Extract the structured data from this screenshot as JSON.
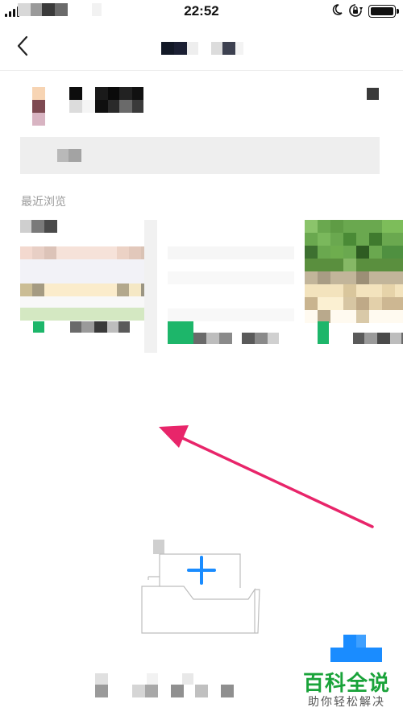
{
  "status_bar": {
    "time": "22:52",
    "battery_level": 1.0,
    "icons": [
      "signal-icon",
      "moon-icon",
      "rotation-lock-icon",
      "battery-icon"
    ]
  },
  "nav": {
    "back_icon": "chevron-left-icon"
  },
  "recent": {
    "section_title": "最近浏览"
  },
  "annotation": {
    "arrow_color": "#e8256a",
    "arrow_icon": "arrow-icon"
  },
  "empty_state": {
    "icon": "empty-folder-plus-icon",
    "accent": "#1a8cff"
  },
  "watermark": {
    "title": "百科全说",
    "subtitle": "助你轻松解决",
    "title_color": "#1aa33a",
    "logo_color": "#1a8cff"
  }
}
